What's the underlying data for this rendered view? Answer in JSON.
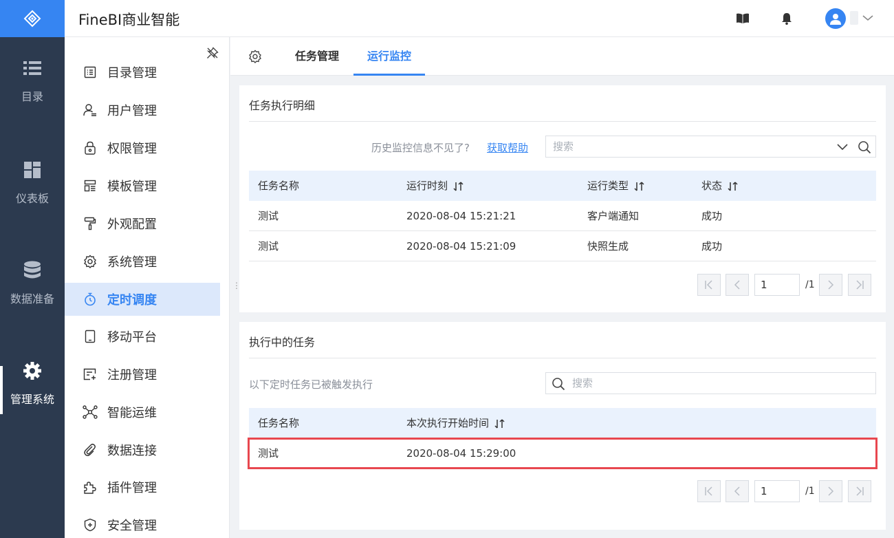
{
  "app": {
    "title": "FineBI商业智能"
  },
  "rail": {
    "items": [
      {
        "label": "目录",
        "icon": "list-icon"
      },
      {
        "label": "仪表板",
        "icon": "dashboard-icon"
      },
      {
        "label": "数据准备",
        "icon": "database-icon"
      },
      {
        "label": "管理系统",
        "icon": "gear-icon",
        "active": true
      }
    ]
  },
  "menu": {
    "items": [
      {
        "label": "目录管理",
        "icon": "directory-icon"
      },
      {
        "label": "用户管理",
        "icon": "user-icon"
      },
      {
        "label": "权限管理",
        "icon": "lock-icon"
      },
      {
        "label": "模板管理",
        "icon": "template-icon"
      },
      {
        "label": "外观配置",
        "icon": "paint-roller-icon"
      },
      {
        "label": "系统管理",
        "icon": "gear-icon"
      },
      {
        "label": "定时调度",
        "icon": "stopwatch-icon",
        "active": true
      },
      {
        "label": "移动平台",
        "icon": "tablet-icon"
      },
      {
        "label": "注册管理",
        "icon": "register-icon"
      },
      {
        "label": "智能运维",
        "icon": "network-icon"
      },
      {
        "label": "数据连接",
        "icon": "paperclip-icon"
      },
      {
        "label": "插件管理",
        "icon": "puzzle-icon"
      },
      {
        "label": "安全管理",
        "icon": "shield-icon"
      }
    ]
  },
  "tabs": [
    {
      "label": "任务管理"
    },
    {
      "label": "运行监控",
      "active": true
    }
  ],
  "history": {
    "title": "任务执行明细",
    "help_text": "历史监控信息不见了?",
    "help_link": "获取帮助",
    "search_placeholder": "搜索",
    "columns": [
      "任务名称",
      "运行时刻",
      "运行类型",
      "状态"
    ],
    "rows": [
      [
        "测试",
        "2020-08-04 15:21:21",
        "客户端通知",
        "成功"
      ],
      [
        "测试",
        "2020-08-04 15:21:09",
        "快照生成",
        "成功"
      ]
    ],
    "pager": {
      "page": "1",
      "total": "/1"
    }
  },
  "running": {
    "title": "执行中的任务",
    "subtitle": "以下定时任务已被触发执行",
    "search_placeholder": "搜索",
    "columns": [
      "任务名称",
      "本次执行开始时间"
    ],
    "rows": [
      [
        "测试",
        "2020-08-04 15:29:00"
      ]
    ],
    "pager": {
      "page": "1",
      "total": "/1"
    }
  },
  "colors": {
    "accent": "#3685f2",
    "rail_bg": "#2c3a4f",
    "highlight": "#e8474f",
    "header_row_bg": "#eaf2fd"
  }
}
